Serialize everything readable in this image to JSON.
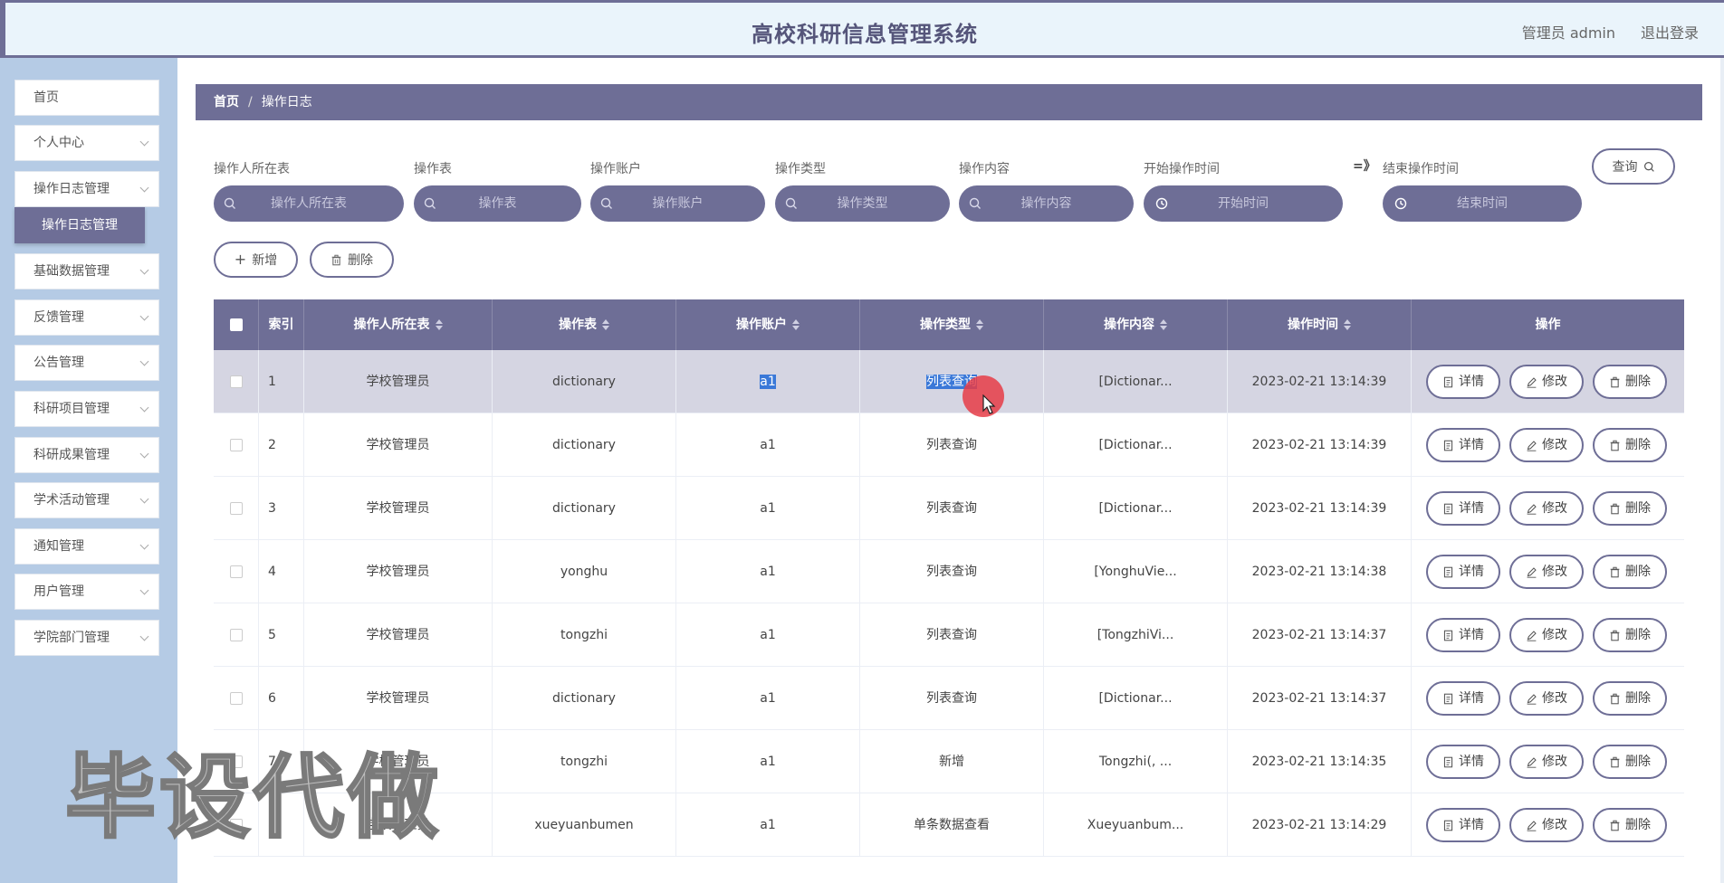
{
  "header": {
    "title": "高校科研信息管理系统",
    "user": "管理员 admin",
    "logout": "退出登录"
  },
  "sidebar": {
    "items": [
      {
        "label": "首页"
      },
      {
        "label": "个人中心"
      },
      {
        "label": "操作日志管理"
      },
      {
        "label": "基础数据管理"
      },
      {
        "label": "反馈管理"
      },
      {
        "label": "公告管理"
      },
      {
        "label": "科研项目管理"
      },
      {
        "label": "科研成果管理"
      },
      {
        "label": "学术活动管理"
      },
      {
        "label": "通知管理"
      },
      {
        "label": "用户管理"
      },
      {
        "label": "学院部门管理"
      }
    ],
    "active_sub": "操作日志管理"
  },
  "breadcrumb": {
    "home": "首页",
    "sep": "/",
    "current": "操作日志"
  },
  "search": {
    "fields": [
      {
        "label": "操作人所在表",
        "placeholder": "操作人所在表"
      },
      {
        "label": "操作表",
        "placeholder": "操作表"
      },
      {
        "label": "操作账户",
        "placeholder": "操作账户"
      },
      {
        "label": "操作类型",
        "placeholder": "操作类型"
      },
      {
        "label": "操作内容",
        "placeholder": "操作内容"
      },
      {
        "label": "开始操作时间",
        "placeholder": "开始时间"
      },
      {
        "label": "结束操作时间",
        "placeholder": "结束时间"
      }
    ],
    "range_sep": "=》",
    "query_label": "查询"
  },
  "toolbar": {
    "add_label": "新增",
    "delete_label": "删除"
  },
  "table": {
    "headers": [
      "索引",
      "操作人所在表",
      "操作表",
      "操作账户",
      "操作类型",
      "操作内容",
      "操作时间",
      "操作"
    ],
    "rows": [
      {
        "idx": "1",
        "user_table": "学校管理员",
        "table": "dictionary",
        "account": "a1",
        "type": "列表查询",
        "content": "[Dictionar...",
        "time": "2023-02-21 13:14:39"
      },
      {
        "idx": "2",
        "user_table": "学校管理员",
        "table": "dictionary",
        "account": "a1",
        "type": "列表查询",
        "content": "[Dictionar...",
        "time": "2023-02-21 13:14:39"
      },
      {
        "idx": "3",
        "user_table": "学校管理员",
        "table": "dictionary",
        "account": "a1",
        "type": "列表查询",
        "content": "[Dictionar...",
        "time": "2023-02-21 13:14:39"
      },
      {
        "idx": "4",
        "user_table": "学校管理员",
        "table": "yonghu",
        "account": "a1",
        "type": "列表查询",
        "content": "[YonghuVie...",
        "time": "2023-02-21 13:14:38"
      },
      {
        "idx": "5",
        "user_table": "学校管理员",
        "table": "tongzhi",
        "account": "a1",
        "type": "列表查询",
        "content": "[TongzhiVi...",
        "time": "2023-02-21 13:14:37"
      },
      {
        "idx": "6",
        "user_table": "学校管理员",
        "table": "dictionary",
        "account": "a1",
        "type": "列表查询",
        "content": "[Dictionar...",
        "time": "2023-02-21 13:14:37"
      },
      {
        "idx": "7",
        "user_table": "学校管理员",
        "table": "tongzhi",
        "account": "a1",
        "type": "新增",
        "content": "Tongzhi(, ...",
        "time": "2023-02-21 13:14:35"
      },
      {
        "idx": "8",
        "user_table": "学校管理员",
        "table": "xueyuanbumen",
        "account": "a1",
        "type": "单条数据查看",
        "content": "Xueyuanbum...",
        "time": "2023-02-21 13:14:29"
      }
    ],
    "actions": {
      "detail": "详情",
      "edit": "修改",
      "delete": "删除"
    }
  },
  "watermark": "毕设代做",
  "colors": {
    "accent": "#6e6e96",
    "sidebar_bg": "#b5cbe5",
    "header_bg": "#eaf4fb",
    "selection": "#3a78d8"
  }
}
